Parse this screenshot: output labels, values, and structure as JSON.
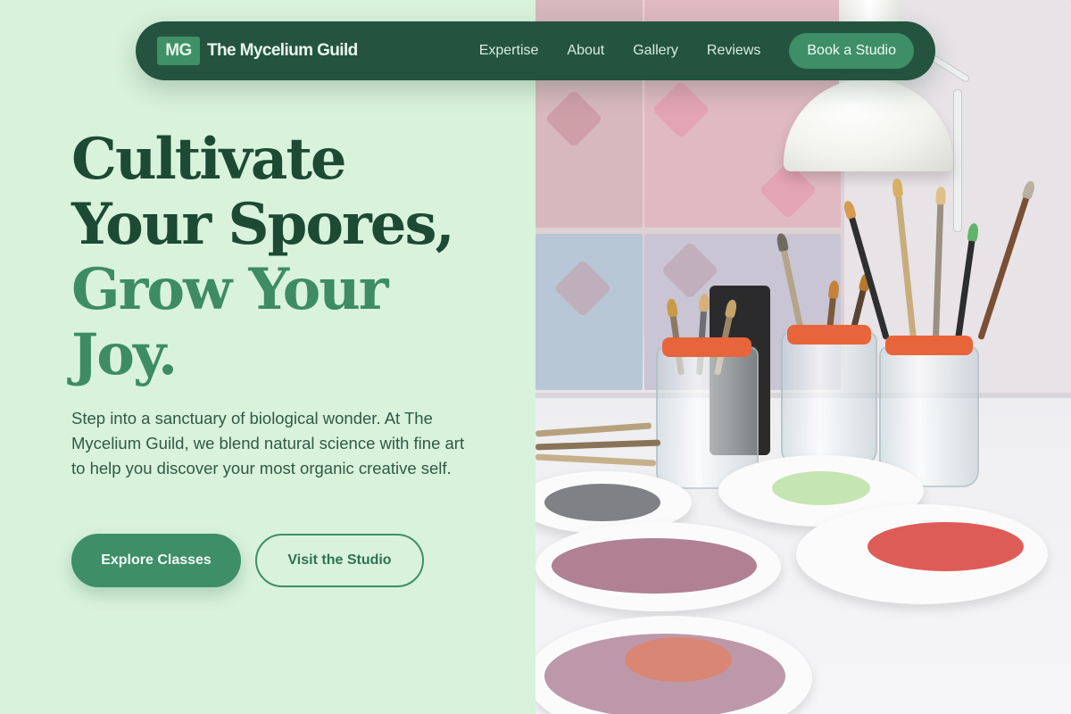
{
  "brand": {
    "badge": "MG",
    "name": "The Mycelium Guild"
  },
  "nav": {
    "links": [
      "Expertise",
      "About",
      "Gallery",
      "Reviews"
    ],
    "cta": "Book a Studio"
  },
  "hero": {
    "headline_dark_1": "Cultivate",
    "headline_dark_2": "Your Spores,",
    "headline_green_1": "Grow Your",
    "headline_green_2": "Joy.",
    "lede": "Step into a sanctuary of biological wonder. At The Mycelium Guild, we blend natural science with fine art to help you discover your most organic creative self.",
    "primary_button": "Explore Classes",
    "secondary_button": "Visit the Studio"
  },
  "colors": {
    "background": "#d9f2dc",
    "nav_bg": "#245440",
    "accent": "#3e8e67",
    "headline_dark": "#1c4a33"
  },
  "image": {
    "subject": "art-studio-brushes-photo"
  }
}
